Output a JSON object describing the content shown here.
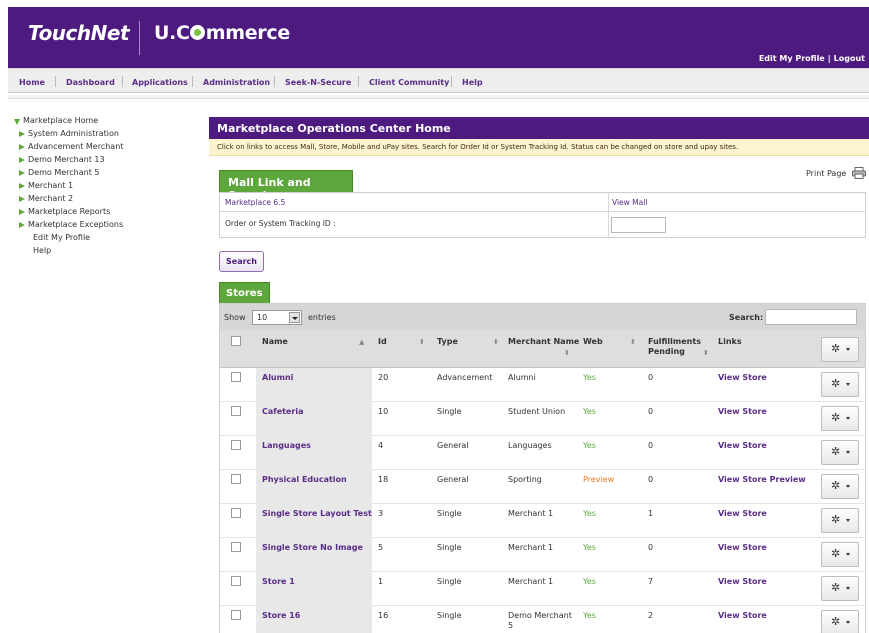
{
  "header": {
    "logo_touchnet": "TouchNet",
    "logo_u": "U.C",
    "logo_rest": "mmerce",
    "edit_profile": "Edit My Profile",
    "separator": "|",
    "logout": "Logout"
  },
  "nav": {
    "items": [
      "Home",
      "Dashboard",
      "Applications",
      "Administration",
      "Seek-N-Secure",
      "Client Community",
      "Help"
    ]
  },
  "sidebar": {
    "items": [
      {
        "label": "Marketplace Home",
        "icon": "triangle-down-icon"
      },
      {
        "label": "System Administration",
        "icon": "triangle-right-icon"
      },
      {
        "label": "Advancement Merchant",
        "icon": "triangle-right-icon"
      },
      {
        "label": "Demo Merchant 13",
        "icon": "triangle-right-icon"
      },
      {
        "label": "Demo Merchant 5",
        "icon": "triangle-right-icon"
      },
      {
        "label": "Merchant 1",
        "icon": "triangle-right-icon"
      },
      {
        "label": "Merchant 2",
        "icon": "triangle-right-icon"
      },
      {
        "label": "Marketplace Reports",
        "icon": "triangle-right-icon"
      },
      {
        "label": "Marketplace Exceptions",
        "icon": "triangle-right-icon"
      },
      {
        "label": "Edit My Profile",
        "icon": ""
      },
      {
        "label": "Help",
        "icon": ""
      }
    ]
  },
  "main": {
    "title": "Marketplace Operations Center Home",
    "notice": "Click on links to access Mall, Store, Mobile and uPay sites. Search for Order Id or System Tracking Id. Status can be changed on store and upay sites.",
    "print_page": "Print Page",
    "mall_tab": "Mall Link and Search",
    "mall_name": "Marketplace 6.5",
    "view_mall": "View Mall",
    "tracking_label": "Order or System Tracking ID :",
    "tracking_value": "",
    "search_button": "Search",
    "stores_tab": "Stores"
  },
  "table": {
    "show_label": "Show",
    "entries_value": "10",
    "entries_label": "entries",
    "search_label": "Search:",
    "search_value": "",
    "headers": {
      "name": "Name",
      "id": "Id",
      "type": "Type",
      "merchant_line1": "Merchant Name",
      "web": "Web",
      "fulfill_line1": "Fulfillments",
      "fulfill_line2": "Pending",
      "links": "Links"
    },
    "rows": [
      {
        "name": "Alumni",
        "id": "20",
        "type": "Advancement",
        "merchant": "Alumni",
        "merchant2": "",
        "web": "Yes",
        "pending": "0",
        "link": "View Store"
      },
      {
        "name": "Cafeteria",
        "id": "10",
        "type": "Single",
        "merchant": "Student Union",
        "merchant2": "",
        "web": "Yes",
        "pending": "0",
        "link": "View Store"
      },
      {
        "name": "Languages",
        "id": "4",
        "type": "General",
        "merchant": "Languages",
        "merchant2": "",
        "web": "Yes",
        "pending": "0",
        "link": "View Store"
      },
      {
        "name": "Physical Education",
        "id": "18",
        "type": "General",
        "merchant": "Sporting",
        "merchant2": "",
        "web": "Preview",
        "pending": "0",
        "link": "View Store Preview"
      },
      {
        "name": "Single Store Layout Test",
        "id": "3",
        "type": "Single",
        "merchant": "Merchant 1",
        "merchant2": "",
        "web": "Yes",
        "pending": "1",
        "link": "View Store"
      },
      {
        "name": "Single Store No Image",
        "id": "5",
        "type": "Single",
        "merchant": "Merchant 1",
        "merchant2": "",
        "web": "Yes",
        "pending": "0",
        "link": "View Store"
      },
      {
        "name": "Store 1",
        "id": "1",
        "type": "Single",
        "merchant": "Merchant 1",
        "merchant2": "",
        "web": "Yes",
        "pending": "7",
        "link": "View Store"
      },
      {
        "name": "Store 16",
        "id": "16",
        "type": "Single",
        "merchant": "Demo Merchant",
        "merchant2": "5",
        "web": "Yes",
        "pending": "2",
        "link": "View Store"
      }
    ]
  },
  "colors": {
    "brand_purple": "#4d1a7f",
    "accent_green": "#5ea73c",
    "preview_orange": "#e87a21",
    "notice_bg": "#fdf4cf"
  }
}
